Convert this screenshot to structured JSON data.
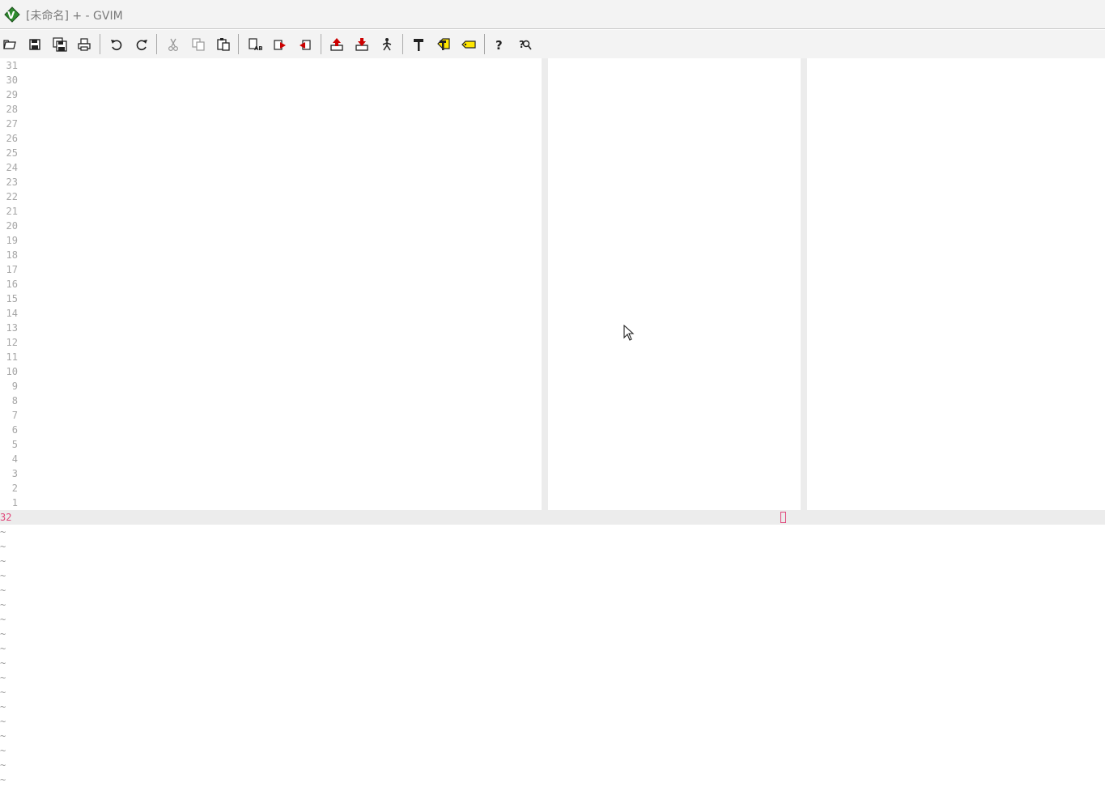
{
  "window": {
    "title": "[未命名] + - GVIM",
    "app_icon": "gvim-logo-icon"
  },
  "toolbar": {
    "items": [
      {
        "name": "open-button",
        "icon": "open-file-icon",
        "tooltip": "Open"
      },
      {
        "name": "save-button",
        "icon": "save-icon",
        "tooltip": "Save"
      },
      {
        "name": "save-all-button",
        "icon": "save-all-icon",
        "tooltip": "Save All"
      },
      {
        "name": "print-button",
        "icon": "print-icon",
        "tooltip": "Print"
      },
      {
        "name": "undo-button",
        "icon": "undo-icon",
        "tooltip": "Undo"
      },
      {
        "name": "redo-button",
        "icon": "redo-icon",
        "tooltip": "Redo"
      },
      {
        "name": "cut-button",
        "icon": "cut-icon",
        "tooltip": "Cut",
        "disabled": true
      },
      {
        "name": "copy-button",
        "icon": "copy-icon",
        "tooltip": "Copy",
        "disabled": true
      },
      {
        "name": "paste-button",
        "icon": "paste-icon",
        "tooltip": "Paste"
      },
      {
        "name": "find-replace-button",
        "icon": "find-replace-icon",
        "tooltip": "Find and Replace"
      },
      {
        "name": "find-next-button",
        "icon": "find-next-icon",
        "tooltip": "Find Next"
      },
      {
        "name": "find-prev-button",
        "icon": "find-prev-icon",
        "tooltip": "Find Previous"
      },
      {
        "name": "load-session-button",
        "icon": "load-session-icon",
        "tooltip": "Load Session"
      },
      {
        "name": "save-session-button",
        "icon": "save-session-icon",
        "tooltip": "Save Session"
      },
      {
        "name": "run-script-button",
        "icon": "run-script-icon",
        "tooltip": "Run Script"
      },
      {
        "name": "make-button",
        "icon": "make-icon",
        "tooltip": "Make"
      },
      {
        "name": "run-ctags-button",
        "icon": "ctags-icon",
        "tooltip": "Run Ctags"
      },
      {
        "name": "jump-to-tag-button",
        "icon": "tag-icon",
        "tooltip": "Jump to Tag"
      },
      {
        "name": "help-button",
        "icon": "help-icon",
        "tooltip": "Help"
      },
      {
        "name": "find-help-button",
        "icon": "find-help-icon",
        "tooltip": "Find Help"
      }
    ]
  },
  "editor": {
    "relative_line_numbers": [
      "31",
      "30",
      "29",
      "28",
      "27",
      "26",
      "25",
      "24",
      "23",
      "22",
      "21",
      "20",
      "19",
      "18",
      "17",
      "16",
      "15",
      "14",
      "13",
      "12",
      "11",
      "10",
      "9",
      "8",
      "7",
      "6",
      "5",
      "4",
      "3",
      "2",
      "1"
    ],
    "current_line_number": "32",
    "empty_line_marker": "~",
    "empty_line_count": 18
  },
  "colors": {
    "accent": "#e0467a",
    "line_number": "#a6a6a6",
    "background": "#ffffff",
    "chrome": "#f3f3f3"
  }
}
